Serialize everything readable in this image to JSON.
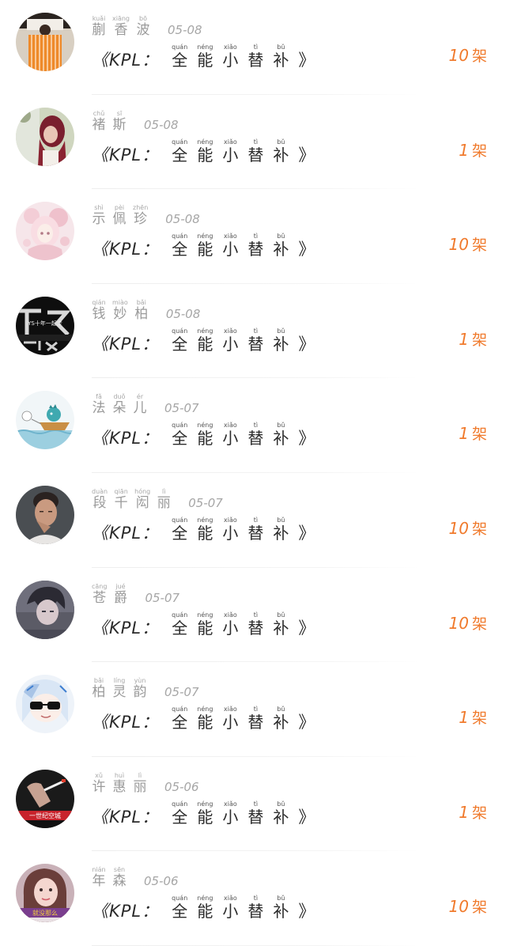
{
  "items": [
    {
      "name": [
        {
          "hz": "蒯",
          "py": "kuǎi"
        },
        {
          "hz": "香",
          "py": "xiāng"
        },
        {
          "hz": "波",
          "py": "bō"
        }
      ],
      "date": "05-08",
      "title_prefix": "《KPL：",
      "title": [
        {
          "hz": "全",
          "py": "quán"
        },
        {
          "hz": "能",
          "py": "néng"
        },
        {
          "hz": "小",
          "py": "xiǎo"
        },
        {
          "hz": "替",
          "py": "tì"
        },
        {
          "hz": "补",
          "py": "bǔ"
        }
      ],
      "title_suffix": "》",
      "count": "10",
      "unit": "架",
      "avatar": "orange-striped-dress-avatar"
    },
    {
      "name": [
        {
          "hz": "褚",
          "py": "chǔ"
        },
        {
          "hz": "斯",
          "py": "sī"
        }
      ],
      "date": "05-08",
      "title_prefix": "《KPL：",
      "title": [
        {
          "hz": "全",
          "py": "quán"
        },
        {
          "hz": "能",
          "py": "néng"
        },
        {
          "hz": "小",
          "py": "xiǎo"
        },
        {
          "hz": "替",
          "py": "tì"
        },
        {
          "hz": "补",
          "py": "bǔ"
        }
      ],
      "title_suffix": "》",
      "count": "1",
      "unit": "架",
      "avatar": "red-hair-girl-avatar"
    },
    {
      "name": [
        {
          "hz": "示",
          "py": "shì"
        },
        {
          "hz": "佩",
          "py": "pèi"
        },
        {
          "hz": "珍",
          "py": "zhēn"
        }
      ],
      "date": "05-08",
      "title_prefix": "《KPL：",
      "title": [
        {
          "hz": "全",
          "py": "quán"
        },
        {
          "hz": "能",
          "py": "néng"
        },
        {
          "hz": "小",
          "py": "xiǎo"
        },
        {
          "hz": "替",
          "py": "tì"
        },
        {
          "hz": "补",
          "py": "bǔ"
        }
      ],
      "title_suffix": "》",
      "count": "10",
      "unit": "架",
      "avatar": "pink-anime-avatar"
    },
    {
      "name": [
        {
          "hz": "钱",
          "py": "qián"
        },
        {
          "hz": "妙",
          "py": "miào"
        },
        {
          "hz": "柏",
          "py": "bǎi"
        }
      ],
      "date": "05-08",
      "title_prefix": "《KPL：",
      "title": [
        {
          "hz": "全",
          "py": "quán"
        },
        {
          "hz": "能",
          "py": "néng"
        },
        {
          "hz": "小",
          "py": "xiǎo"
        },
        {
          "hz": "替",
          "py": "tì"
        },
        {
          "hz": "补",
          "py": "bǔ"
        }
      ],
      "title_suffix": "》",
      "count": "1",
      "unit": "架",
      "avatar": "dark-text-avatar",
      "avatar_text": "YS十年一起走"
    },
    {
      "name": [
        {
          "hz": "法",
          "py": "fǎ"
        },
        {
          "hz": "朵",
          "py": "duǒ"
        },
        {
          "hz": "儿",
          "py": "ér"
        }
      ],
      "date": "05-07",
      "title_prefix": "《KPL：",
      "title": [
        {
          "hz": "全",
          "py": "quán"
        },
        {
          "hz": "能",
          "py": "néng"
        },
        {
          "hz": "小",
          "py": "xiǎo"
        },
        {
          "hz": "替",
          "py": "tì"
        },
        {
          "hz": "补",
          "py": "bǔ"
        }
      ],
      "title_suffix": "》",
      "count": "1",
      "unit": "架",
      "avatar": "cartoon-boat-avatar"
    },
    {
      "name": [
        {
          "hz": "段",
          "py": "duàn"
        },
        {
          "hz": "千",
          "py": "qiān"
        },
        {
          "hz": "闳",
          "py": "hóng"
        },
        {
          "hz": "丽",
          "py": "lì"
        }
      ],
      "date": "05-07",
      "title_prefix": "《KPL：",
      "title": [
        {
          "hz": "全",
          "py": "quán"
        },
        {
          "hz": "能",
          "py": "néng"
        },
        {
          "hz": "小",
          "py": "xiǎo"
        },
        {
          "hz": "替",
          "py": "tì"
        },
        {
          "hz": "补",
          "py": "bǔ"
        }
      ],
      "title_suffix": "》",
      "count": "10",
      "unit": "架",
      "avatar": "man-portrait-avatar"
    },
    {
      "name": [
        {
          "hz": "苍",
          "py": "cāng"
        },
        {
          "hz": "爵",
          "py": "jué"
        }
      ],
      "date": "05-07",
      "title_prefix": "《KPL：",
      "title": [
        {
          "hz": "全",
          "py": "quán"
        },
        {
          "hz": "能",
          "py": "néng"
        },
        {
          "hz": "小",
          "py": "xiǎo"
        },
        {
          "hz": "替",
          "py": "tì"
        },
        {
          "hz": "补",
          "py": "bǔ"
        }
      ],
      "title_suffix": "》",
      "count": "10",
      "unit": "架",
      "avatar": "dark-anime-boy-avatar"
    },
    {
      "name": [
        {
          "hz": "柏",
          "py": "bǎi"
        },
        {
          "hz": "灵",
          "py": "líng"
        },
        {
          "hz": "韵",
          "py": "yùn"
        }
      ],
      "date": "05-07",
      "title_prefix": "《KPL：",
      "title": [
        {
          "hz": "全",
          "py": "quán"
        },
        {
          "hz": "能",
          "py": "néng"
        },
        {
          "hz": "小",
          "py": "xiǎo"
        },
        {
          "hz": "替",
          "py": "tì"
        },
        {
          "hz": "补",
          "py": "bǔ"
        }
      ],
      "title_suffix": "》",
      "count": "1",
      "unit": "架",
      "avatar": "sunglasses-anime-avatar"
    },
    {
      "name": [
        {
          "hz": "许",
          "py": "xǔ"
        },
        {
          "hz": "惠",
          "py": "huì"
        },
        {
          "hz": "丽",
          "py": "lì"
        }
      ],
      "date": "05-06",
      "title_prefix": "《KPL：",
      "title": [
        {
          "hz": "全",
          "py": "quán"
        },
        {
          "hz": "能",
          "py": "néng"
        },
        {
          "hz": "小",
          "py": "xiǎo"
        },
        {
          "hz": "替",
          "py": "tì"
        },
        {
          "hz": "补",
          "py": "bǔ"
        }
      ],
      "title_suffix": "》",
      "count": "1",
      "unit": "架",
      "avatar": "cigarette-hand-avatar",
      "avatar_text": "一世纪空城"
    },
    {
      "name": [
        {
          "hz": "年",
          "py": "nián"
        },
        {
          "hz": "森",
          "py": "sēn"
        }
      ],
      "date": "05-06",
      "title_prefix": "《KPL：",
      "title": [
        {
          "hz": "全",
          "py": "quán"
        },
        {
          "hz": "能",
          "py": "néng"
        },
        {
          "hz": "小",
          "py": "xiǎo"
        },
        {
          "hz": "替",
          "py": "tì"
        },
        {
          "hz": "补",
          "py": "bǔ"
        }
      ],
      "title_suffix": "》",
      "count": "10",
      "unit": "架",
      "avatar": "girl-selfie-avatar",
      "avatar_text": "就没那么"
    }
  ],
  "colors": {
    "count": "#f07a2c",
    "name": "#9a9a9a",
    "title": "#2b2b2b"
  }
}
